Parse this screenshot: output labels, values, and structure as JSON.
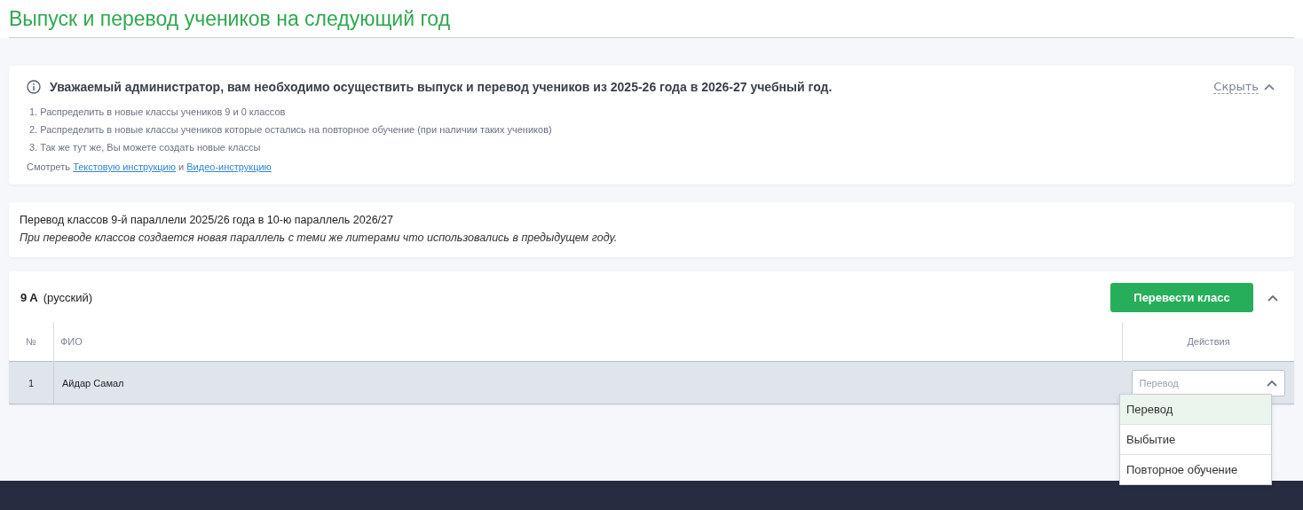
{
  "page_title": "Выпуск и перевод учеников на следующий год",
  "notice": {
    "heading": "Уважаемый администратор, вам необходимо осуществить выпуск и перевод учеников из 2025-26 года в 2026-27 учебный год.",
    "toggle": "Скрыть",
    "expanded": true,
    "steps": [
      "1. Распределить в новые классы учеников 9 и 0 классов",
      "2. Распределить в новые классы учеников которые остались на повторное обучение (при наличии таких учеников)",
      "3. Так же тут же, Вы можете создать новые классы"
    ],
    "links_prefix": "Смотреть",
    "links": [
      "Текстовую инструкцию",
      "Видео-инструкцию"
    ],
    "links_joiner": "и"
  },
  "transfer_info": {
    "title": "Перевод классов 9-й параллели 2025/26 года в 10-ю параллель 2026/27",
    "note": "При переводе классов создается новая параллель с теми же литерами что использовались в предыдущем году."
  },
  "class_panel": {
    "class_name": "9 A",
    "language": "(русский)",
    "button": "Перевести класс",
    "expanded": true,
    "table": {
      "columns": [
        "№",
        "ФИО",
        "Действия"
      ],
      "rows": [
        {
          "number": "1",
          "name": "Айдар Самал",
          "action": {
            "placeholder": "Перевод",
            "expanded": true,
            "options": [
              {
                "label": "Перевод",
                "selected": true
              },
              {
                "label": "Выбытие",
                "selected": false
              },
              {
                "label": "Повторное обучение",
                "selected": false
              }
            ]
          }
        }
      ]
    }
  }
}
